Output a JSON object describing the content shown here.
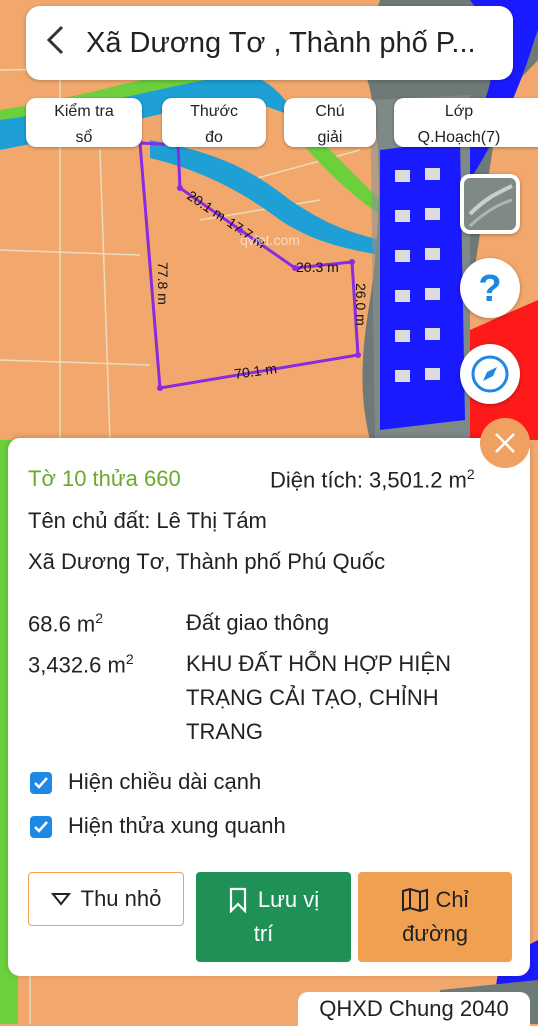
{
  "header": {
    "back_icon": "chevron-left-icon",
    "title": "Xã Dương Tơ , Thành phố P..."
  },
  "chips": [
    {
      "line1": "Kiểm tra",
      "line2": "sổ"
    },
    {
      "line1": "Thước",
      "line2": "đo"
    },
    {
      "line1": "Chú",
      "line2": "giải"
    },
    {
      "line1": "Lớp",
      "line2": "Q.Hoạch(7)"
    }
  ],
  "map": {
    "edge_labels": [
      "20.1 m",
      "17.7 m",
      "20.3 m",
      "26.0 m",
      "70.1 m",
      "77.8 m"
    ],
    "watermark": "qvlet.com",
    "colors": {
      "land": "#f2a86c",
      "river": "#1e9fd6",
      "parcel_outline": "#8a2be2",
      "road": "#1a1aff",
      "commercial": "#ff1a1a",
      "green": "#6bd03c"
    }
  },
  "fabs": {
    "layers_icon": "satellite-layer-icon",
    "help_icon": "help-icon",
    "compass_icon": "compass-icon"
  },
  "panel": {
    "parcel": "Tờ 10 thửa 660",
    "area_label": "Diện tích: 3,501.2 m",
    "area_sup": "2",
    "owner": "Tên chủ đất: Lê Thị Tám",
    "address": "Xã Dương Tơ, Thành phố Phú Quốc",
    "zones": [
      {
        "area": "68.6 m",
        "sup": "2",
        "type": "Đất giao thông"
      },
      {
        "area": "3,432.6 m",
        "sup": "2",
        "type_line1": "KHU ĐẤT HỖN HỢP HIỆN",
        "type_line2": "TRẠNG CẢI TẠO, CHỈNH",
        "type_line3": "TRANG"
      }
    ],
    "checkbox1": "Hiện chiều dài cạnh",
    "checkbox2": "Hiện thửa xung quanh",
    "collapse_button": "Thu nhỏ",
    "save_line1": "Lưu vị",
    "save_line2": "trí",
    "directions_line1": "Chỉ",
    "directions_line2": "đường",
    "save_color": "#1f9156",
    "directions_color": "#f0a050"
  },
  "footer_tag": "QHXD Chung 2040"
}
